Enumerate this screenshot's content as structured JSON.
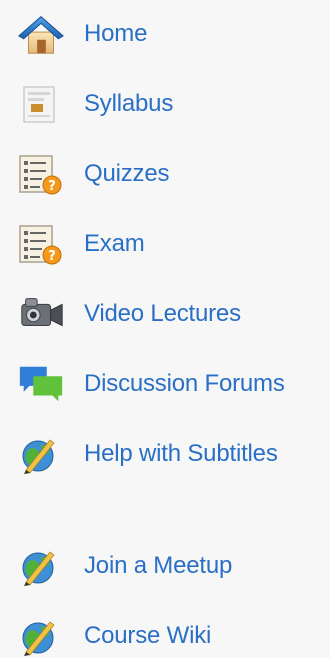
{
  "sidebar": {
    "link_color": "#2a6fc6",
    "background": "#f7f7f7",
    "items": [
      {
        "label": "Home",
        "icon": "house-icon"
      },
      {
        "label": "Syllabus",
        "icon": "document-icon"
      },
      {
        "label": "Quizzes",
        "icon": "quiz-sheet-icon"
      },
      {
        "label": "Exam",
        "icon": "exam-sheet-icon"
      },
      {
        "label": "Video Lectures",
        "icon": "video-camera-icon"
      },
      {
        "label": "Discussion Forums",
        "icon": "chat-bubbles-icon"
      },
      {
        "label": "Help with Subtitles",
        "icon": "globe-pencil-icon"
      },
      {
        "label": "Join a Meetup",
        "icon": "globe-pencil-icon"
      },
      {
        "label": "Course Wiki",
        "icon": "globe-pencil-icon"
      }
    ]
  }
}
